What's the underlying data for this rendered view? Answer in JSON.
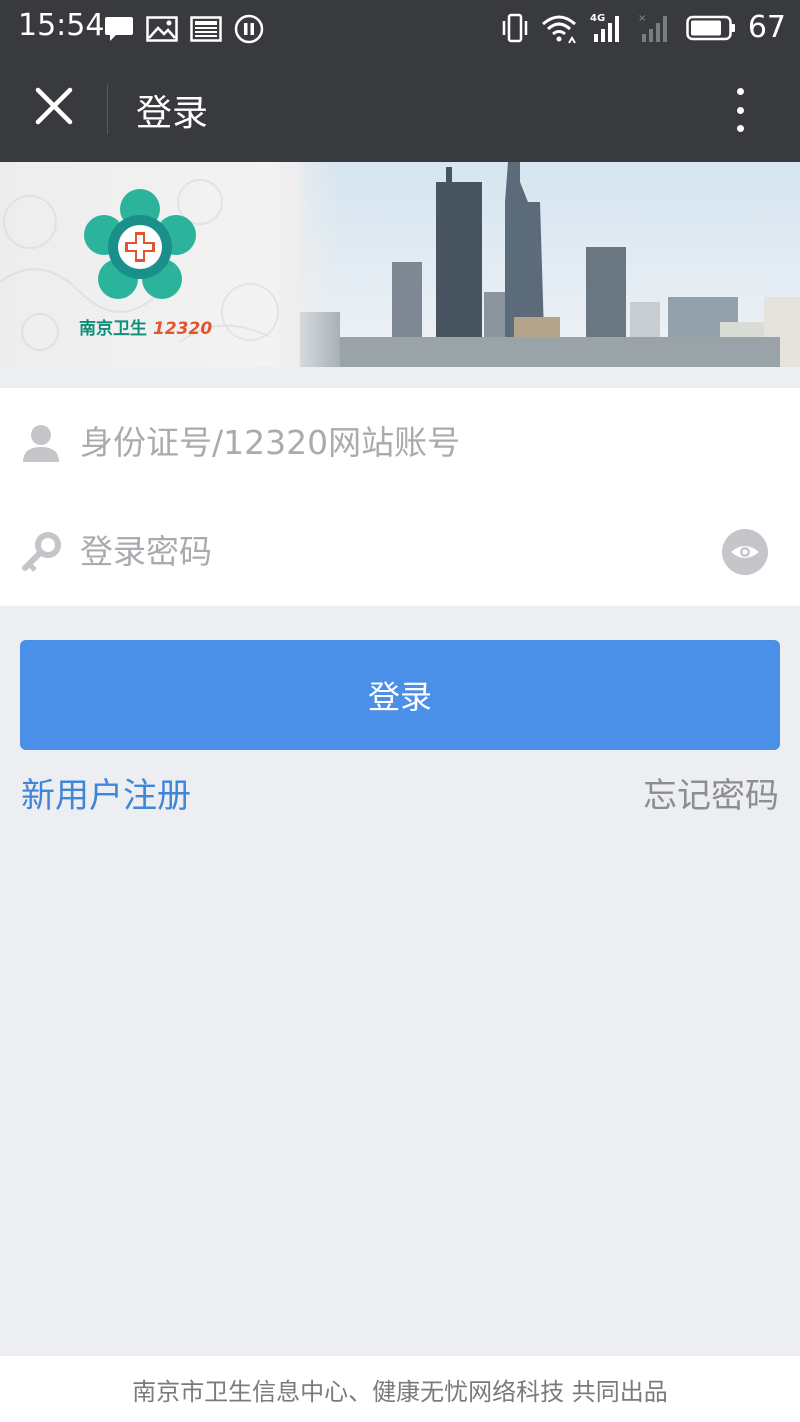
{
  "status_bar": {
    "time": "15:54",
    "battery": "67",
    "network": "4G",
    "left_icons": [
      "message-icon",
      "image-icon",
      "news-icon",
      "pause-icon"
    ],
    "right_icons": [
      "vibrate-icon",
      "wifi-icon",
      "signal-4g-icon",
      "signal-empty-icon",
      "battery-icon"
    ]
  },
  "nav": {
    "title": "登录",
    "close_icon": "close-icon",
    "more_icon": "more-vertical-icon"
  },
  "banner": {
    "logo_text": "南京卫生",
    "logo_number": "12320"
  },
  "form": {
    "username_placeholder": "身份证号/12320网站账号",
    "password_placeholder": "登录密码",
    "username_icon": "user-icon",
    "password_icon": "key-icon",
    "eye_icon": "eye-icon"
  },
  "actions": {
    "login_label": "登录",
    "register_label": "新用户注册",
    "forgot_label": "忘记密码"
  },
  "colors": {
    "primary": "#4a8fe8",
    "link": "#3f86d9",
    "header": "#383a3e",
    "background": "#eceef2"
  },
  "footer": {
    "text": "南京市卫生信息中心、健康无忧网络科技 共同出品"
  }
}
